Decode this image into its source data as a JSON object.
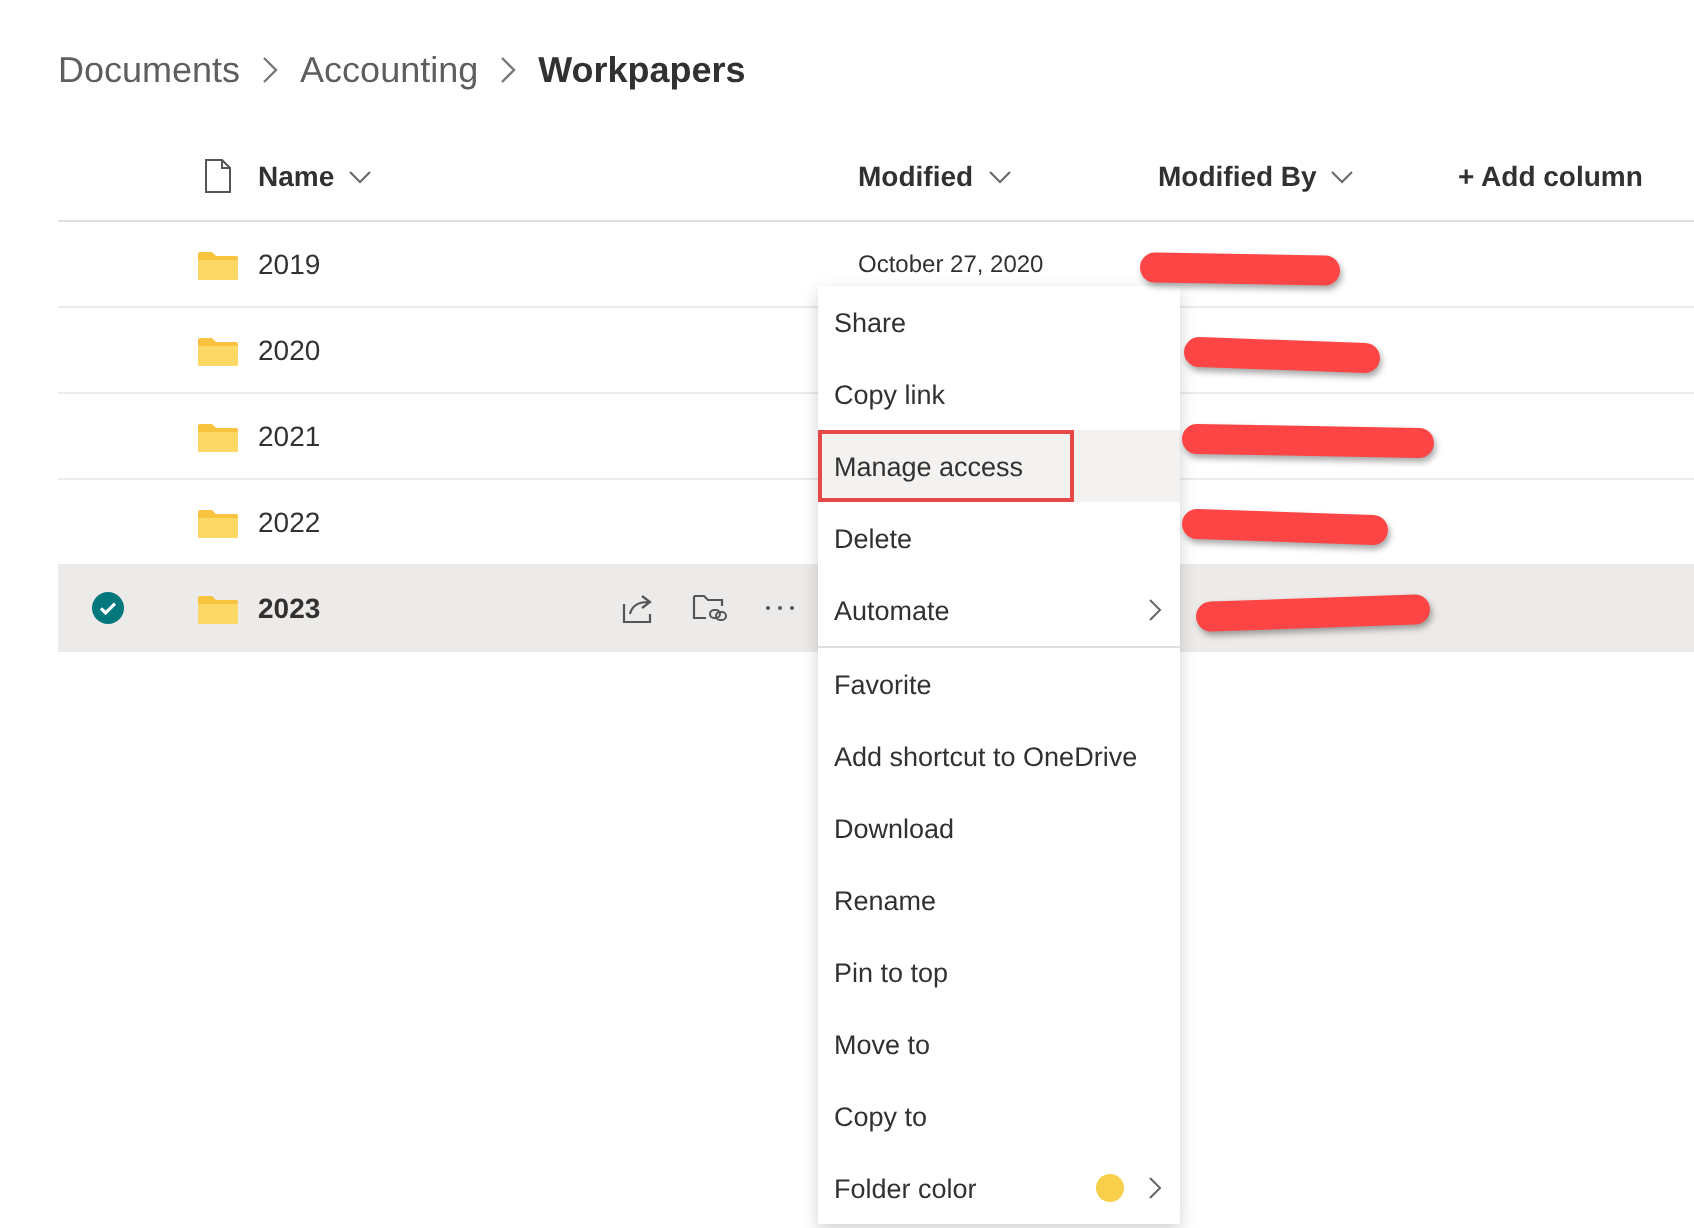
{
  "breadcrumb": [
    {
      "label": "Documents",
      "current": false
    },
    {
      "label": "Accounting",
      "current": false
    },
    {
      "label": "Workpapers",
      "current": true
    }
  ],
  "columns": [
    {
      "label": "Name",
      "kind": "name"
    },
    {
      "label": "Modified",
      "kind": "sort"
    },
    {
      "label": "Modified By",
      "kind": "sort"
    },
    {
      "label": "+ Add column",
      "kind": "add"
    }
  ],
  "rows": [
    {
      "name": "2019",
      "modified": "October 27, 2020",
      "selected": false,
      "redacted": true
    },
    {
      "name": "2020",
      "selected": false,
      "redacted": true
    },
    {
      "name": "2021",
      "selected": false,
      "redacted": true
    },
    {
      "name": "2022",
      "selected": false,
      "redacted": true
    },
    {
      "name": "2023",
      "selected": true,
      "redacted": true
    }
  ],
  "context_menu": [
    {
      "label": "Share",
      "highlighted": false,
      "annotated": false,
      "submenu": false
    },
    {
      "label": "Copy link",
      "highlighted": false,
      "annotated": false,
      "submenu": false
    },
    {
      "label": "Manage access",
      "highlighted": true,
      "annotated": true,
      "submenu": false
    },
    {
      "label": "Delete",
      "highlighted": false,
      "annotated": false,
      "submenu": false
    },
    {
      "label": "Automate",
      "highlighted": false,
      "annotated": false,
      "submenu": true
    },
    {
      "label": "Favorite",
      "highlighted": false,
      "annotated": false,
      "submenu": false,
      "divider_before": true
    },
    {
      "label": "Add shortcut to OneDrive",
      "highlighted": false,
      "annotated": false,
      "submenu": false
    },
    {
      "label": "Download",
      "highlighted": false,
      "annotated": false,
      "submenu": false
    },
    {
      "label": "Rename",
      "highlighted": false,
      "annotated": false,
      "submenu": false
    },
    {
      "label": "Pin to top",
      "highlighted": false,
      "annotated": false,
      "submenu": false
    },
    {
      "label": "Move to",
      "highlighted": false,
      "annotated": false,
      "submenu": false
    },
    {
      "label": "Copy to",
      "highlighted": false,
      "annotated": false,
      "submenu": false
    },
    {
      "label": "Folder color",
      "highlighted": false,
      "annotated": false,
      "submenu": true,
      "color": "#f7cf4a"
    }
  ]
}
